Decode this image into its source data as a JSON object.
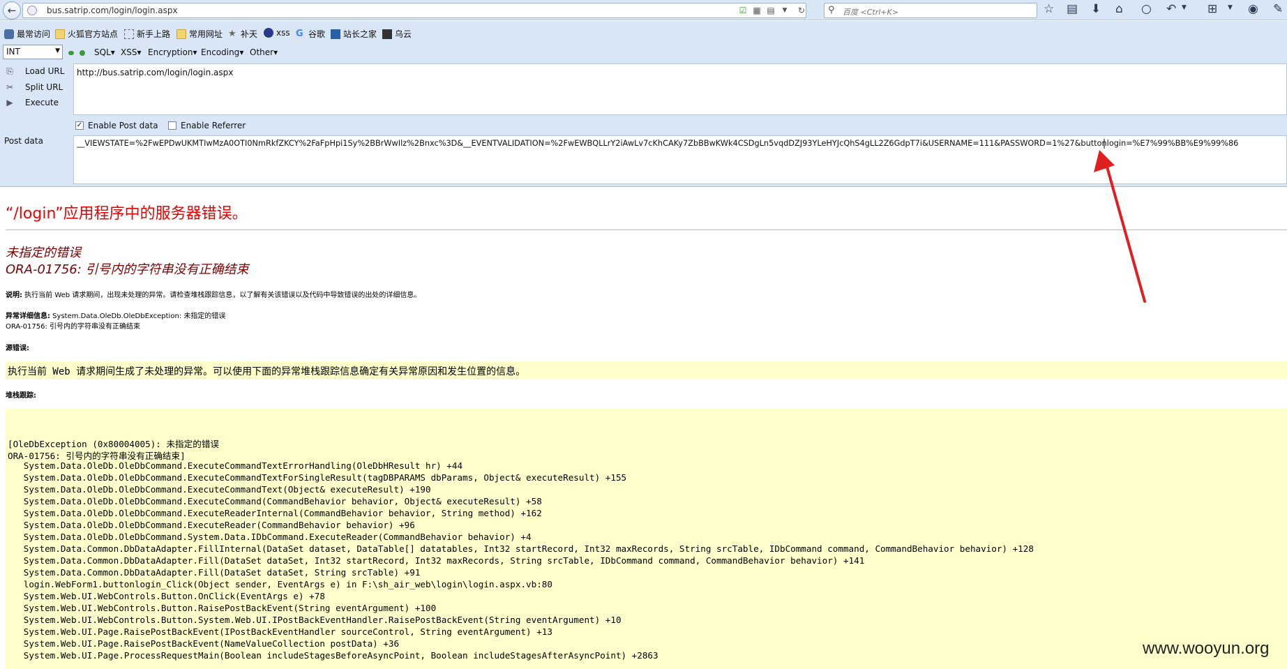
{
  "browser": {
    "url": "bus.satrip.com/login/login.aspx",
    "search_placeholder": "百度 <Ctrl+K>"
  },
  "bookmarks": [
    {
      "label": "最常访问",
      "icon": "gear-icon"
    },
    {
      "label": "火狐官方站点",
      "icon": "folder-icon"
    },
    {
      "label": "新手上路",
      "icon": "dotted-box-icon"
    },
    {
      "label": "常用网址",
      "icon": "folder-icon"
    },
    {
      "label": "补天",
      "icon": "star-icon"
    },
    {
      "label": "xss",
      "icon": "globe-icon"
    },
    {
      "label": "谷歌",
      "icon": "google-icon"
    },
    {
      "label": "站长之家",
      "icon": "bookmark-icon"
    },
    {
      "label": "乌云",
      "icon": "wooyun-icon"
    }
  ],
  "hackbar": {
    "type_select": "INT",
    "menus": [
      "SQL",
      "XSS",
      "Encryption",
      "Encoding",
      "Other"
    ],
    "load_url": "Load URL",
    "split_url": "Split URL",
    "execute": "Execute",
    "url_value": "http://bus.satrip.com/login/login.aspx",
    "enable_post": "Enable Post data",
    "enable_referrer": "Enable Referrer",
    "post_label": "Post data",
    "post_value": "__VIEWSTATE=%2FwEPDwUKMTIwMzA0OTI0NmRkfZKCY%2FaFpHpi1Sy%2BBrWwIlz%2Bnxc%3D&__EVENTVALIDATION=%2FwEWBQLLrY2iAwLv7cKhCAKy7ZbBBwKWk4CSDgLn5vqdDZJ93YLeHYJcQhS4gLL2Z6GdpT7i&USERNAME=111&PASSWORD=1%27&buttonlogin=%E7%99%BB%E9%99%86"
  },
  "page": {
    "title": "“/login”应用程序中的服务器错误。",
    "subtitle1": "未指定的错误",
    "subtitle2": "ORA-01756: 引号内的字符串没有正确结束",
    "desc_label": "说明:",
    "desc_text": " 执行当前 Web 请求期间，出现未处理的异常。请检查堆栈跟踪信息，以了解有关该错误以及代码中导致错误的出处的详细信息。",
    "exc_label": "异常详细信息:",
    "exc_text": " System.Data.OleDb.OleDbException: 未指定的错误",
    "exc_text2": "ORA-01756: 引号内的字符串没有正确结束",
    "src_label": "源错误:",
    "src_text": "执行当前 Web 请求期间生成了未处理的异常。可以使用下面的异常堆栈跟踪信息确定有关异常原因和发生位置的信息。",
    "stack_label": "堆栈跟踪:",
    "stack": [
      "[OleDbException (0x80004005): 未指定的错误",
      "ORA-01756: 引号内的字符串没有正确结束]",
      "   System.Data.OleDb.OleDbCommand.ExecuteCommandTextErrorHandling(OleDbHResult hr) +44",
      "   System.Data.OleDb.OleDbCommand.ExecuteCommandTextForSingleResult(tagDBPARAMS dbParams, Object& executeResult) +155",
      "   System.Data.OleDb.OleDbCommand.ExecuteCommandText(Object& executeResult) +190",
      "   System.Data.OleDb.OleDbCommand.ExecuteCommand(CommandBehavior behavior, Object& executeResult) +58",
      "   System.Data.OleDb.OleDbCommand.ExecuteReaderInternal(CommandBehavior behavior, String method) +162",
      "   System.Data.OleDb.OleDbCommand.ExecuteReader(CommandBehavior behavior) +96",
      "   System.Data.OleDb.OleDbCommand.System.Data.IDbCommand.ExecuteReader(CommandBehavior behavior) +4",
      "   System.Data.Common.DbDataAdapter.FillInternal(DataSet dataset, DataTable[] datatables, Int32 startRecord, Int32 maxRecords, String srcTable, IDbCommand command, CommandBehavior behavior) +128",
      "   System.Data.Common.DbDataAdapter.Fill(DataSet dataSet, Int32 startRecord, Int32 maxRecords, String srcTable, IDbCommand command, CommandBehavior behavior) +141",
      "   System.Data.Common.DbDataAdapter.Fill(DataSet dataSet, String srcTable) +91",
      "   login.WebForm1.buttonlogin_Click(Object sender, EventArgs e) in F:\\sh_air_web\\login\\login.aspx.vb:80",
      "   System.Web.UI.WebControls.Button.OnClick(EventArgs e) +78",
      "   System.Web.UI.WebControls.Button.RaisePostBackEvent(String eventArgument) +100",
      "   System.Web.UI.WebControls.Button.System.Web.UI.IPostBackEventHandler.RaisePostBackEvent(String eventArgument) +10",
      "   System.Web.UI.Page.RaisePostBackEvent(IPostBackEventHandler sourceControl, String eventArgument) +13",
      "   System.Web.UI.Page.RaisePostBackEvent(NameValueCollection postData) +36",
      "   System.Web.UI.Page.ProcessRequestMain(Boolean includeStagesBeforeAsyncPoint, Boolean includeStagesAfterAsyncPoint) +2863"
    ]
  },
  "watermark": "www.wooyun.org",
  "colors": {
    "title_red": "#e00000",
    "subtitle": "#800000",
    "yellow_bg": "#ffffcc",
    "chrome_bg": "#d8e6f5",
    "arrow": "#e02020"
  }
}
